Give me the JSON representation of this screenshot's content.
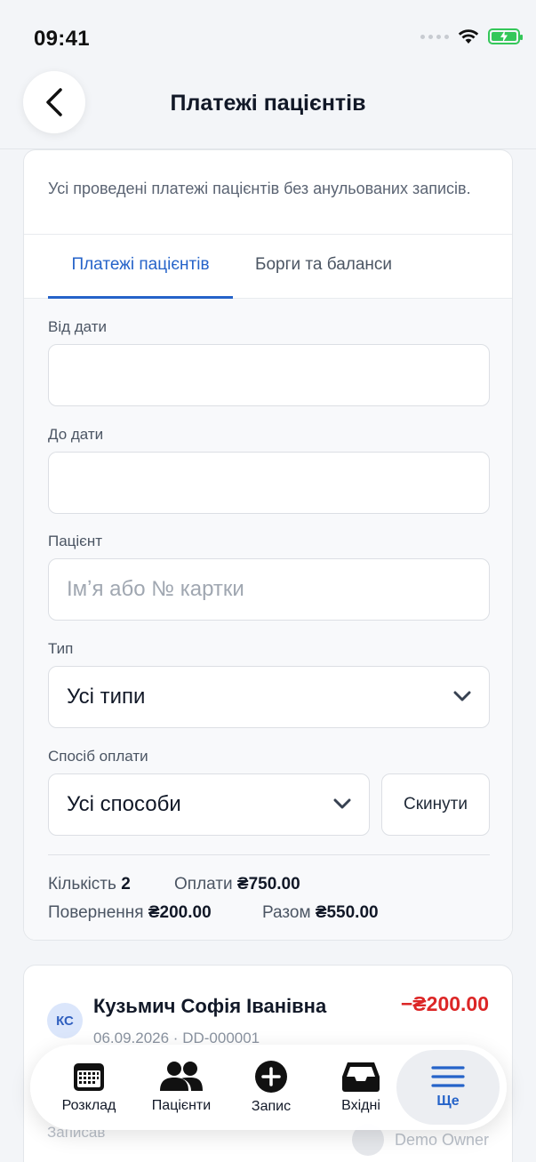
{
  "status_bar": {
    "time": "09:41"
  },
  "header": {
    "title": "Платежі пацієнтів"
  },
  "filters_card": {
    "description": "Усі проведені платежі пацієнтів без анульованих записів.",
    "tabs": [
      {
        "label": "Платежі пацієнтів",
        "active": true
      },
      {
        "label": "Борги та баланси",
        "active": false
      }
    ],
    "from_date": {
      "label": "Від дати",
      "value": ""
    },
    "to_date": {
      "label": "До дати",
      "value": ""
    },
    "patient": {
      "label": "Пацієнт",
      "placeholder": "Імʼя або № картки"
    },
    "type": {
      "label": "Тип",
      "value": "Усі типи"
    },
    "payment_method": {
      "label": "Спосіб оплати",
      "value": "Усі способи"
    },
    "reset_label": "Скинути",
    "summary": {
      "count_label": "Кількість",
      "count": "2",
      "payments_label": "Оплати",
      "payments": "₴750.00",
      "refunds_label": "Повернення",
      "refunds": "₴200.00",
      "total_label": "Разом",
      "total": "₴550.00"
    }
  },
  "payments": [
    {
      "initials": "КС",
      "name": "Кузьмич Софія Іванівна",
      "amount": "−₴200.00",
      "date_code": "06.09.2026 · DD-000001",
      "note": "Записав",
      "owner": "Demo Owner"
    }
  ],
  "tabbar": {
    "items": [
      {
        "label": "Розклад",
        "icon": "calendar-icon"
      },
      {
        "label": "Пацієнти",
        "icon": "people-icon"
      },
      {
        "label": "Запис",
        "icon": "plus-circle-icon"
      },
      {
        "label": "Вхідні",
        "icon": "inbox-icon"
      },
      {
        "label": "Ще",
        "icon": "menu-icon",
        "active": true
      }
    ]
  },
  "colors": {
    "accent": "#2563c9",
    "negative": "#dc2626"
  }
}
